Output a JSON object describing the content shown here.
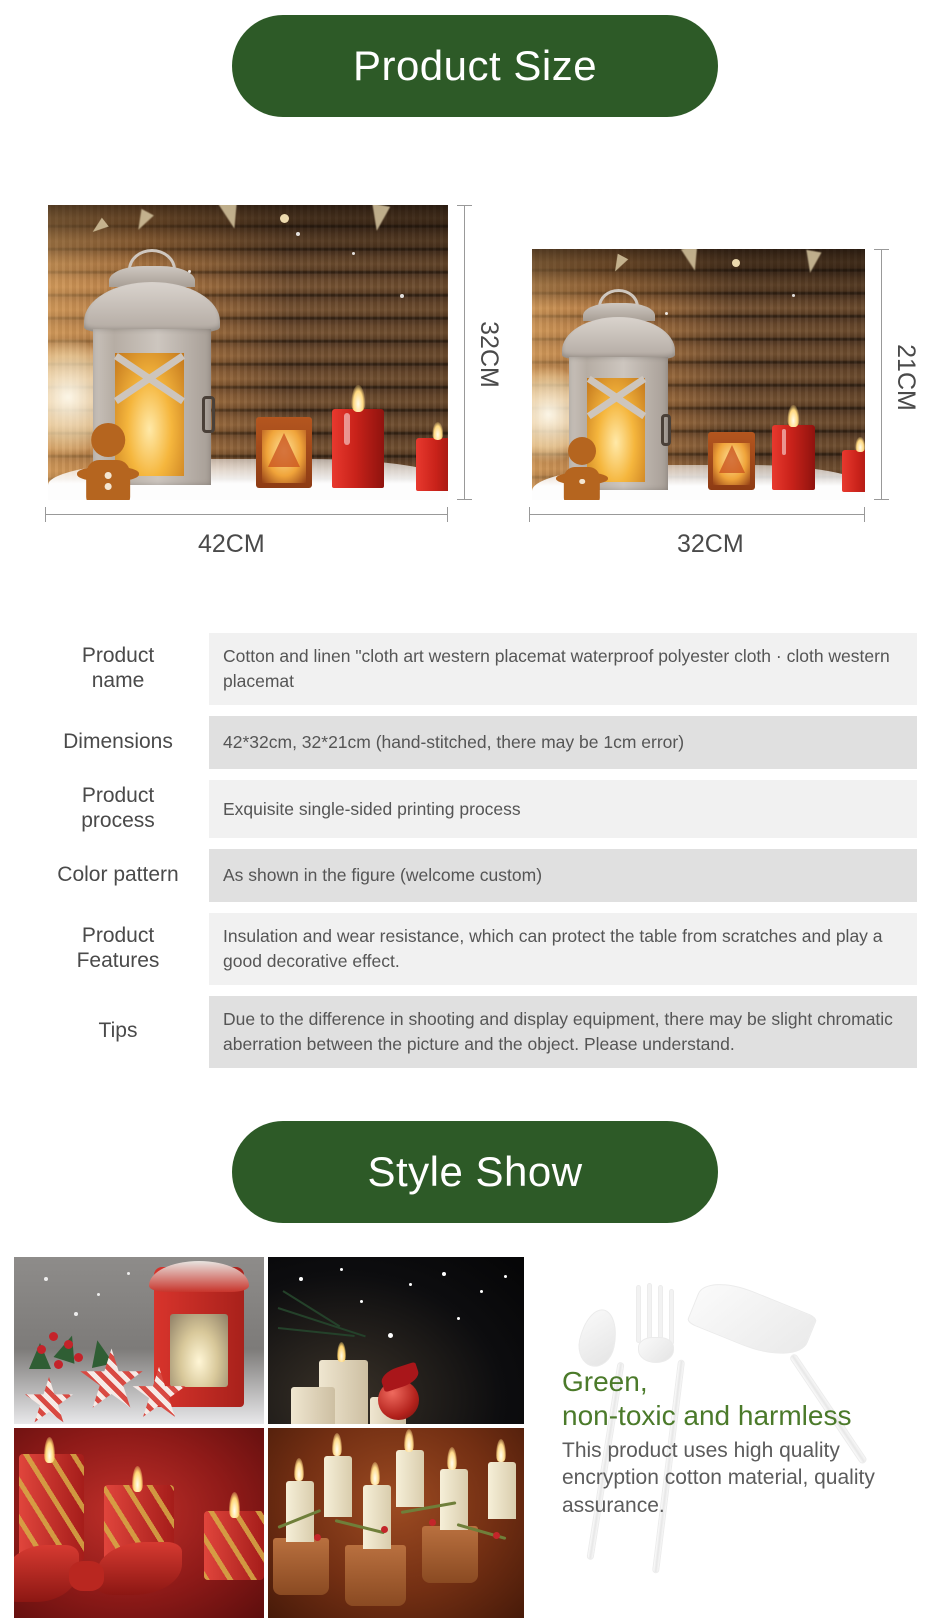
{
  "sections": {
    "product_size_banner": "Product Size",
    "style_show_banner": "Style Show"
  },
  "size_diagram": {
    "large": {
      "width_label": "42CM",
      "height_label": "32CM"
    },
    "small": {
      "width_label": "32CM",
      "height_label": "21CM"
    }
  },
  "spec_table": {
    "rows": [
      {
        "key": "Product\nname",
        "value": "Cotton and linen \"cloth art western placemat waterproof polyester cloth · cloth western placemat"
      },
      {
        "key": "Dimensions",
        "value": "42*32cm, 32*21cm (hand-stitched, there may be 1cm error)"
      },
      {
        "key": "Product\nprocess",
        "value": "Exquisite single-sided printing process"
      },
      {
        "key": "Color pattern",
        "value": "As shown in the figure (welcome custom)"
      },
      {
        "key": "Product\nFeatures",
        "value": "Insulation and wear resistance, which can protect the table from scratches and play a good decorative effect."
      },
      {
        "key": "Tips",
        "value": "Due to the difference in shooting and display equipment, there may be slight chromatic aberration between the picture and the object. Please understand."
      }
    ]
  },
  "promo": {
    "title_line1": "Green,",
    "title_line2": "non-toxic and harmless",
    "body": "This product uses high quality encryption cotton material, quality assurance."
  },
  "colors": {
    "banner_green": "#2d5a27",
    "promo_green": "#4b7a2a",
    "row_light": "#f1f1f1",
    "row_dark": "#e0e0e0",
    "body_text": "#555555"
  }
}
